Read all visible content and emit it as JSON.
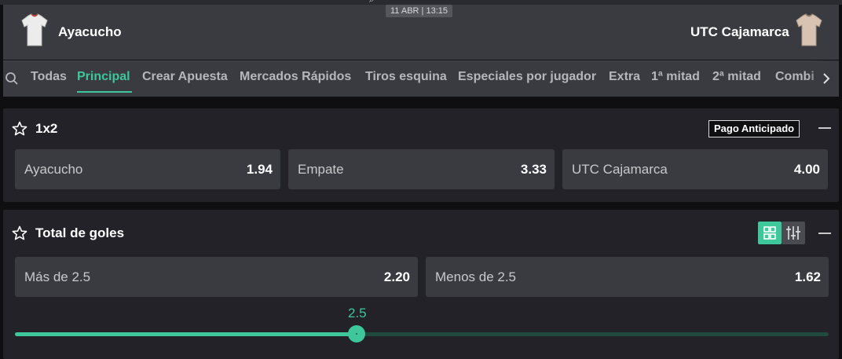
{
  "header": {
    "datetime": "11 ABR | 13:15",
    "home_team": "Ayacucho",
    "away_team": "UTC Cajamarca"
  },
  "tabs": [
    {
      "label": "Todas"
    },
    {
      "label": "Principal"
    },
    {
      "label": "Crear Apuesta"
    },
    {
      "label": "Mercados Rápidos"
    },
    {
      "label": "Tiros esquina"
    },
    {
      "label": "Especiales por jugador"
    },
    {
      "label": "Extra"
    },
    {
      "label": "1ª mitad"
    },
    {
      "label": "2ª mitad"
    },
    {
      "label": "Combi"
    }
  ],
  "markets": {
    "m1x2": {
      "title": "1x2",
      "badge": "Pago Anticipado",
      "outcomes": [
        {
          "label": "Ayacucho",
          "odds": "1.94"
        },
        {
          "label": "Empate",
          "odds": "3.33"
        },
        {
          "label": "UTC Cajamarca",
          "odds": "4.00"
        }
      ]
    },
    "total": {
      "title": "Total de goles",
      "outcomes": [
        {
          "label": "Más de 2.5",
          "odds": "2.20"
        },
        {
          "label": "Menos de 2.5",
          "odds": "1.62"
        }
      ],
      "slider": {
        "value": "2.5",
        "position_fraction": 0.42
      }
    }
  },
  "colors": {
    "accent": "#3ec79a",
    "panel": "#222228",
    "button": "#3a3b40"
  },
  "icons": {
    "search": "search-icon",
    "next": "chevron-right-icon",
    "favorite": "star-icon",
    "collapse": "minus-icon",
    "grid": "grid-view-icon",
    "sliders": "sliders-icon",
    "jersey": "jersey-icon"
  }
}
